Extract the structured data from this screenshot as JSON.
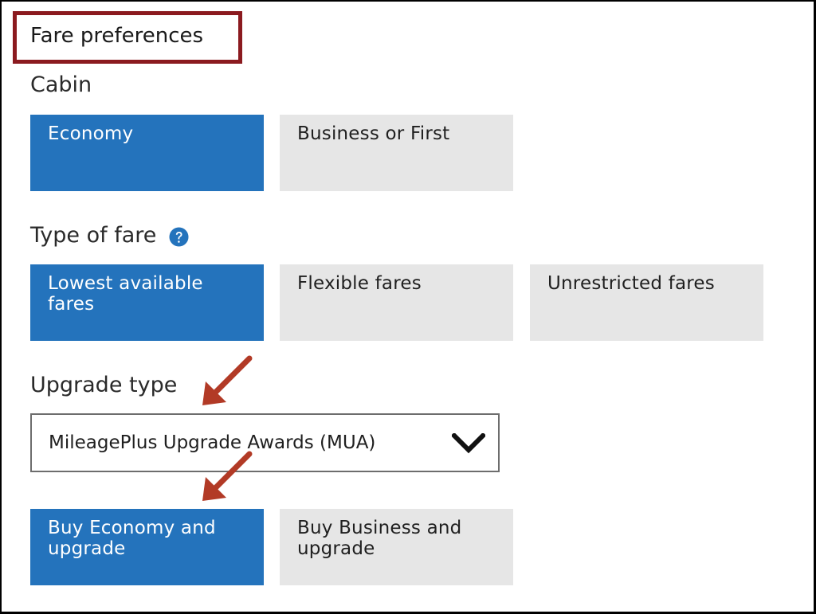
{
  "title": "Fare preferences",
  "cabin": {
    "label": "Cabin",
    "options": [
      {
        "label": "Economy",
        "selected": true
      },
      {
        "label": "Business or First",
        "selected": false
      }
    ]
  },
  "fare_type": {
    "label": "Type of fare",
    "help_icon": "question-circle-icon",
    "options": [
      {
        "label": "Lowest available fares",
        "selected": true
      },
      {
        "label": "Flexible fares",
        "selected": false
      },
      {
        "label": "Unrestricted fares",
        "selected": false
      }
    ]
  },
  "upgrade": {
    "label": "Upgrade type",
    "dropdown_value": "MileagePlus Upgrade Awards (MUA)",
    "dropdown_icon": "chevron-down-icon",
    "options": [
      {
        "label": "Buy Economy and upgrade",
        "selected": true
      },
      {
        "label": "Buy Business and upgrade",
        "selected": false
      }
    ]
  },
  "annotations": {
    "highlight_color": "#8b1a1f",
    "arrow_color": "#b23a26",
    "arrow_icon": "annotation-arrow-icon"
  },
  "colors": {
    "selected_bg": "#2473bc",
    "unselected_bg": "#e6e6e6"
  }
}
